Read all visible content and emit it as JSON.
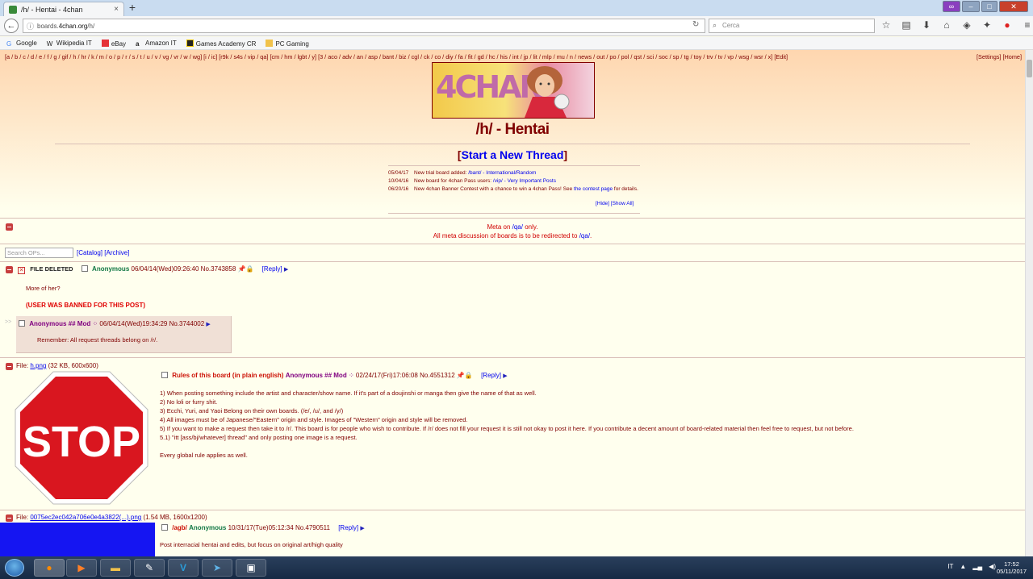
{
  "browser": {
    "tab_title": "/h/ - Hentai - 4chan",
    "tab_close": "×",
    "new_tab": "+",
    "url_prefix": "boards.",
    "url_domain": "4chan.org",
    "url_path": "/h/",
    "search_placeholder": "Cerca",
    "bookmarks": [
      "Google",
      "Wikipedia IT",
      "eBay",
      "Amazon IT",
      "Games Academy CR",
      "PC Gaming"
    ]
  },
  "board": {
    "boardlist": "[a / b / c / d / e / f / g / gif / h / hr / k / m / o / p / r / s / t / u / v / vg / vr / w / wg] [i / ic] [r9k / s4s / vip / qa] [cm / hm / lgbt / y] [3 / aco / adv / an / asp / bant / biz / cgl / ck / co / diy / fa / fit / gd / hc / his / int / jp / lit / mlp / mu / n / news / out / po / pol / qst / sci / soc / sp / tg / toy / trv / tv / vp / wsg / wsr / x] [Edit]",
    "boardlist_right": "[Settings] [Home]",
    "banner_text": "4CHAN",
    "title": "/h/ - Hentai",
    "start_thread_pre": "[",
    "start_thread_label": "Start a New Thread",
    "start_thread_post": "]",
    "news": [
      {
        "date": "05/04/17",
        "text_pre": "New trial board added: ",
        "link": "/bant/ - International/Random",
        "text_post": ""
      },
      {
        "date": "10/04/16",
        "text_pre": "New board for 4chan Pass users: ",
        "link": "/vip/ - Very Important Posts",
        "text_post": ""
      },
      {
        "date": "06/20/16",
        "text_pre": "New 4chan Banner Contest with a chance to win a 4chan Pass! See ",
        "link": "the contest page",
        "text_post": " for details."
      }
    ],
    "news_controls": "[Hide] [Show All]",
    "global_msg_1_pre": "Meta on ",
    "global_msg_1_link": "/qa/",
    "global_msg_1_post": " only.",
    "global_msg_2_pre": "All meta discussion of boards is to be redirected to ",
    "global_msg_2_link": "/qa/",
    "global_msg_2_post": ".",
    "search_placeholder": "Search OPs...",
    "catalog_label": "[Catalog]",
    "archive_label": "[Archive]"
  },
  "threads": [
    {
      "file_deleted": "FILE DELETED",
      "name": "Anonymous",
      "datetime": "06/04/14(Wed)09:26:40",
      "no": "No.3743858",
      "reply": "[Reply]",
      "message": "More of her?",
      "ban": "(USER WAS BANNED FOR THIS POST)",
      "reply_post": {
        "arrows": ">>",
        "name": "Anonymous ## Mod",
        "datetime": "06/04/14(Wed)19:34:29",
        "no": "No.3744002",
        "message": "Remember: All request threads belong on /r/."
      }
    },
    {
      "file_label": "File: ",
      "file_name": "h.png",
      "file_info": "(32 KB, 600x600)",
      "image_text": "STOP",
      "subject": "Rules of this board (in plain english)",
      "name": "Anonymous ## Mod",
      "datetime": "02/24/17(Fri)17:06:08",
      "no": "No.4551312",
      "reply": "[Reply]",
      "lines": [
        "1) When posting something include the artist and character/show name. If it's part of a doujinshi or manga then give the name of that as well.",
        "2) No loli or furry shit.",
        "3) Ecchi, Yuri, and Yaoi Belong on their own boards. (/e/, /u/, and /y/)",
        "4) All images must be of Japanese/\"Eastern\" origin and style. Images of \"Western\" origin and style will be removed.",
        "5) If you want to make a request then take it to /r/. This board is for people who wish to contribute. If /r/ does not fill your request it is still not okay to post it here. If you contribute a decent amount of board-related material then feel free to request, but not before.",
        "5.1) \"itt [ass/bj/whatever] thread\" and only posting one image is a request.",
        "",
        "Every global rule applies as well."
      ]
    },
    {
      "file_label": "File: ",
      "file_name": "0075ec2ec042a706e0e4a3822(...).png",
      "file_info": "(1.54 MB, 1600x1200)",
      "subject": "/agb/",
      "name": "Anonymous",
      "datetime": "10/31/17(Tue)05:12:34",
      "no": "No.4790511",
      "reply": "[Reply]",
      "message": "Post interracial hentai and edits, but focus on original art/high quality"
    }
  ],
  "taskbar": {
    "tray_lang": "IT",
    "time": "17:52",
    "date": "05/11/2017"
  }
}
